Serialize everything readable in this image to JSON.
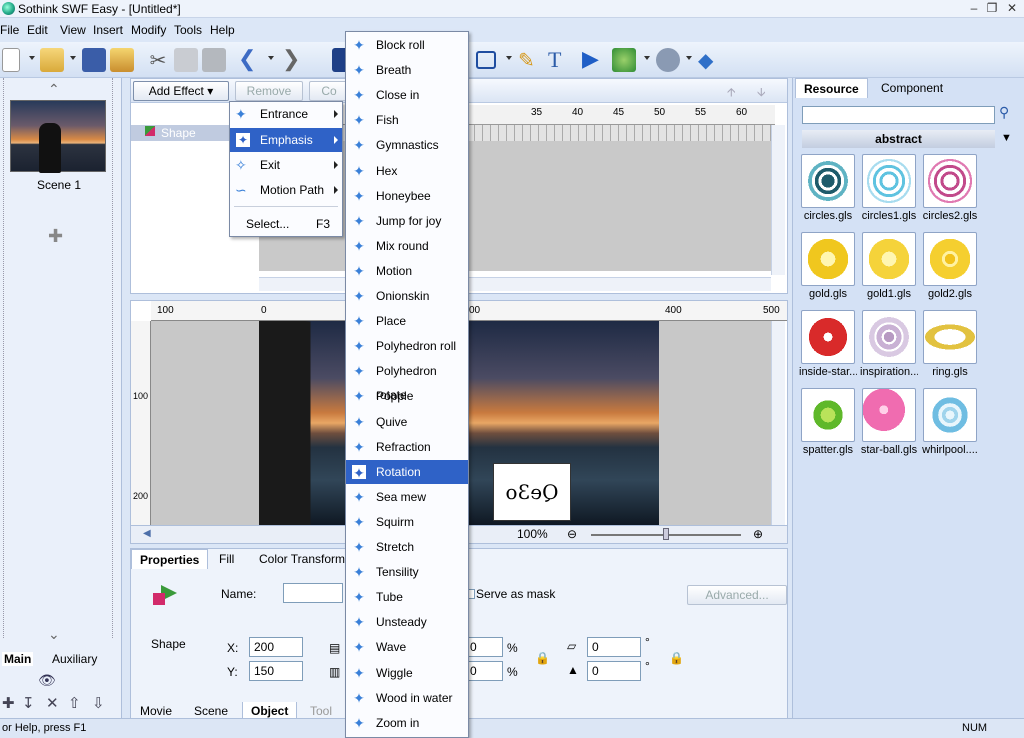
{
  "window": {
    "title": "Sothink SWF Easy - [Untitled*]"
  },
  "menubar": [
    "File",
    "Edit",
    "View",
    "Insert",
    "Modify",
    "Tools",
    "Help"
  ],
  "scenes": {
    "items": [
      {
        "label": "Scene 1"
      }
    ]
  },
  "left_tabs": {
    "main": "Main",
    "auxiliary": "Auxiliary"
  },
  "effect_toolbar": {
    "add_effect": "Add Effect",
    "remove": "Remove",
    "co": "Co"
  },
  "timeline": {
    "layer": "Shape",
    "ruler": [
      "35",
      "40",
      "45",
      "50",
      "55",
      "60"
    ]
  },
  "context_menu": {
    "items": [
      {
        "label": "Entrance",
        "icon": "entrance-icon",
        "submenu": true
      },
      {
        "label": "Emphasis",
        "icon": "emphasis-icon",
        "submenu": true,
        "selected": true
      },
      {
        "label": "Exit",
        "icon": "exit-icon",
        "submenu": true
      },
      {
        "label": "Motion Path",
        "icon": "motion-path-icon",
        "submenu": true
      }
    ],
    "select": {
      "label": "Select...",
      "shortcut": "F3"
    }
  },
  "emphasis_menu": {
    "items": [
      "Block roll",
      "Breath",
      "Close in",
      "Fish",
      "Gymnastics",
      "Hex",
      "Honeybee",
      "Jump for joy",
      "Mix round",
      "Motion",
      "Onionskin",
      "Place",
      "Polyhedron roll",
      "Polyhedron rotate",
      "Popple",
      "Quive",
      "Refraction",
      "Rotation",
      "Sea mew",
      "Squirm",
      "Stretch",
      "Tensility",
      "Tube",
      "Unsteady",
      "Wave",
      "Wiggle",
      "Wood in water",
      "Zoom in"
    ],
    "selected": "Rotation"
  },
  "stage": {
    "ruler_h": [
      "100",
      "0",
      "00",
      "400",
      "500"
    ],
    "ruler_v": [
      "100",
      "200"
    ],
    "zoom": "100%",
    "sample_text": "Qe3o"
  },
  "properties": {
    "tabs": [
      "Properties",
      "Fill",
      "Color Transform"
    ],
    "name_label": "Name:",
    "name_value": "",
    "object_type": "Shape",
    "x_label": "X:",
    "x_value": "200",
    "y_label": "Y:",
    "y_value": "150",
    "w_value": "0",
    "h_value": "0",
    "pct": "%",
    "serve_as_mask": "Serve as mask",
    "advanced": "Advanced...",
    "skew1": "0",
    "skew2": "0",
    "deg": "°"
  },
  "bottom_tabs": [
    "Movie",
    "Scene",
    "Object",
    "Tool"
  ],
  "resource_panel": {
    "tabs": [
      "Resource",
      "Component"
    ],
    "category": "abstract",
    "items": [
      {
        "label": "circles.gls",
        "icon": "circles-icon"
      },
      {
        "label": "circles1.gls",
        "icon": "circles1-icon"
      },
      {
        "label": "circles2.gls",
        "icon": "circles2-icon"
      },
      {
        "label": "gold.gls",
        "icon": "gold-icon"
      },
      {
        "label": "gold1.gls",
        "icon": "gold1-icon"
      },
      {
        "label": "gold2.gls",
        "icon": "gold2-icon"
      },
      {
        "label": "inside-star...",
        "icon": "inside-star-icon"
      },
      {
        "label": "inspiration....",
        "icon": "inspiration-icon"
      },
      {
        "label": "ring.gls",
        "icon": "ring-icon"
      },
      {
        "label": "spatter.gls",
        "icon": "spatter-icon"
      },
      {
        "label": "star-ball.gls",
        "icon": "star-ball-icon"
      },
      {
        "label": "whirlpool....",
        "icon": "whirlpool-icon"
      }
    ]
  },
  "statusbar": {
    "help": "or Help, press F1",
    "num": "NUM"
  }
}
